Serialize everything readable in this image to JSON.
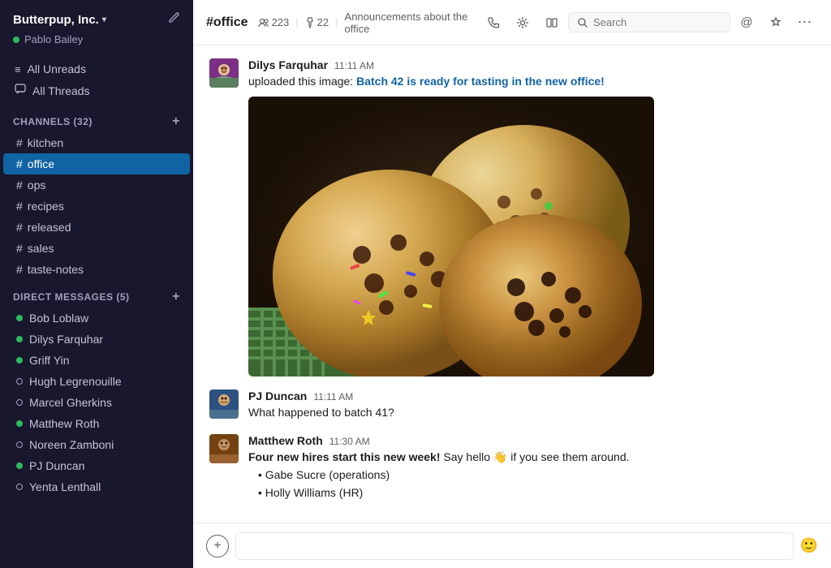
{
  "workspace": {
    "name": "Butterpup, Inc.",
    "chevron": "▾",
    "edit_icon": "✏"
  },
  "user": {
    "name": "Pablo Bailey",
    "status": "online"
  },
  "sidebar": {
    "nav": [
      {
        "id": "unreads",
        "label": "All Unreads",
        "icon": "≡"
      },
      {
        "id": "threads",
        "label": "All Threads",
        "icon": "💬"
      }
    ],
    "channels_header": "CHANNELS",
    "channels_count": "32",
    "channels": [
      {
        "id": "kitchen",
        "name": "kitchen",
        "active": false
      },
      {
        "id": "office",
        "name": "office",
        "active": true
      },
      {
        "id": "ops",
        "name": "ops",
        "active": false
      },
      {
        "id": "recipes",
        "name": "recipes",
        "active": false
      },
      {
        "id": "released",
        "name": "released",
        "active": false
      },
      {
        "id": "sales",
        "name": "sales",
        "active": false
      },
      {
        "id": "taste-notes",
        "name": "taste-notes",
        "active": false
      }
    ],
    "dm_header": "DIRECT MESSAGES",
    "dm_count": "5",
    "dms": [
      {
        "id": "bob",
        "name": "Bob Loblaw",
        "status": "online"
      },
      {
        "id": "dilys",
        "name": "Dilys Farquhar",
        "status": "online"
      },
      {
        "id": "griff",
        "name": "Griff Yin",
        "status": "online"
      },
      {
        "id": "hugh",
        "name": "Hugh Legrenouille",
        "status": "offline"
      },
      {
        "id": "marcel",
        "name": "Marcel Gherkins",
        "status": "offline"
      },
      {
        "id": "matthew",
        "name": "Matthew Roth",
        "status": "online"
      },
      {
        "id": "noreen",
        "name": "Noreen Zamboni",
        "status": "offline"
      },
      {
        "id": "pj",
        "name": "PJ Duncan",
        "status": "online"
      },
      {
        "id": "yenta",
        "name": "Yenta Lenthall",
        "status": "offline"
      }
    ]
  },
  "channel": {
    "name": "#office",
    "members": "223",
    "members_icon": "👥",
    "pinned": "22",
    "pin_icon": "📌",
    "description": "Announcements about the office"
  },
  "messages": [
    {
      "id": "msg1",
      "author": "Dilys Farquhar",
      "time": "11:11 AM",
      "text_prefix": "uploaded this image: ",
      "link_text": "Batch 42 is ready for tasting in the new office!",
      "has_image": true
    },
    {
      "id": "msg2",
      "author": "PJ Duncan",
      "time": "11:11 AM",
      "text": "What happened to batch 41?"
    },
    {
      "id": "msg3",
      "author": "Matthew Roth",
      "time": "11:30 AM",
      "text_bold": "Four new hires start this new week!",
      "text_suffix": " Say hello 👋 if you see them around.",
      "bullets": [
        "Gabe Sucre (operations)",
        "Holly Williams (HR)"
      ]
    }
  ],
  "search": {
    "placeholder": "Search"
  },
  "composer": {
    "placeholder": ""
  }
}
